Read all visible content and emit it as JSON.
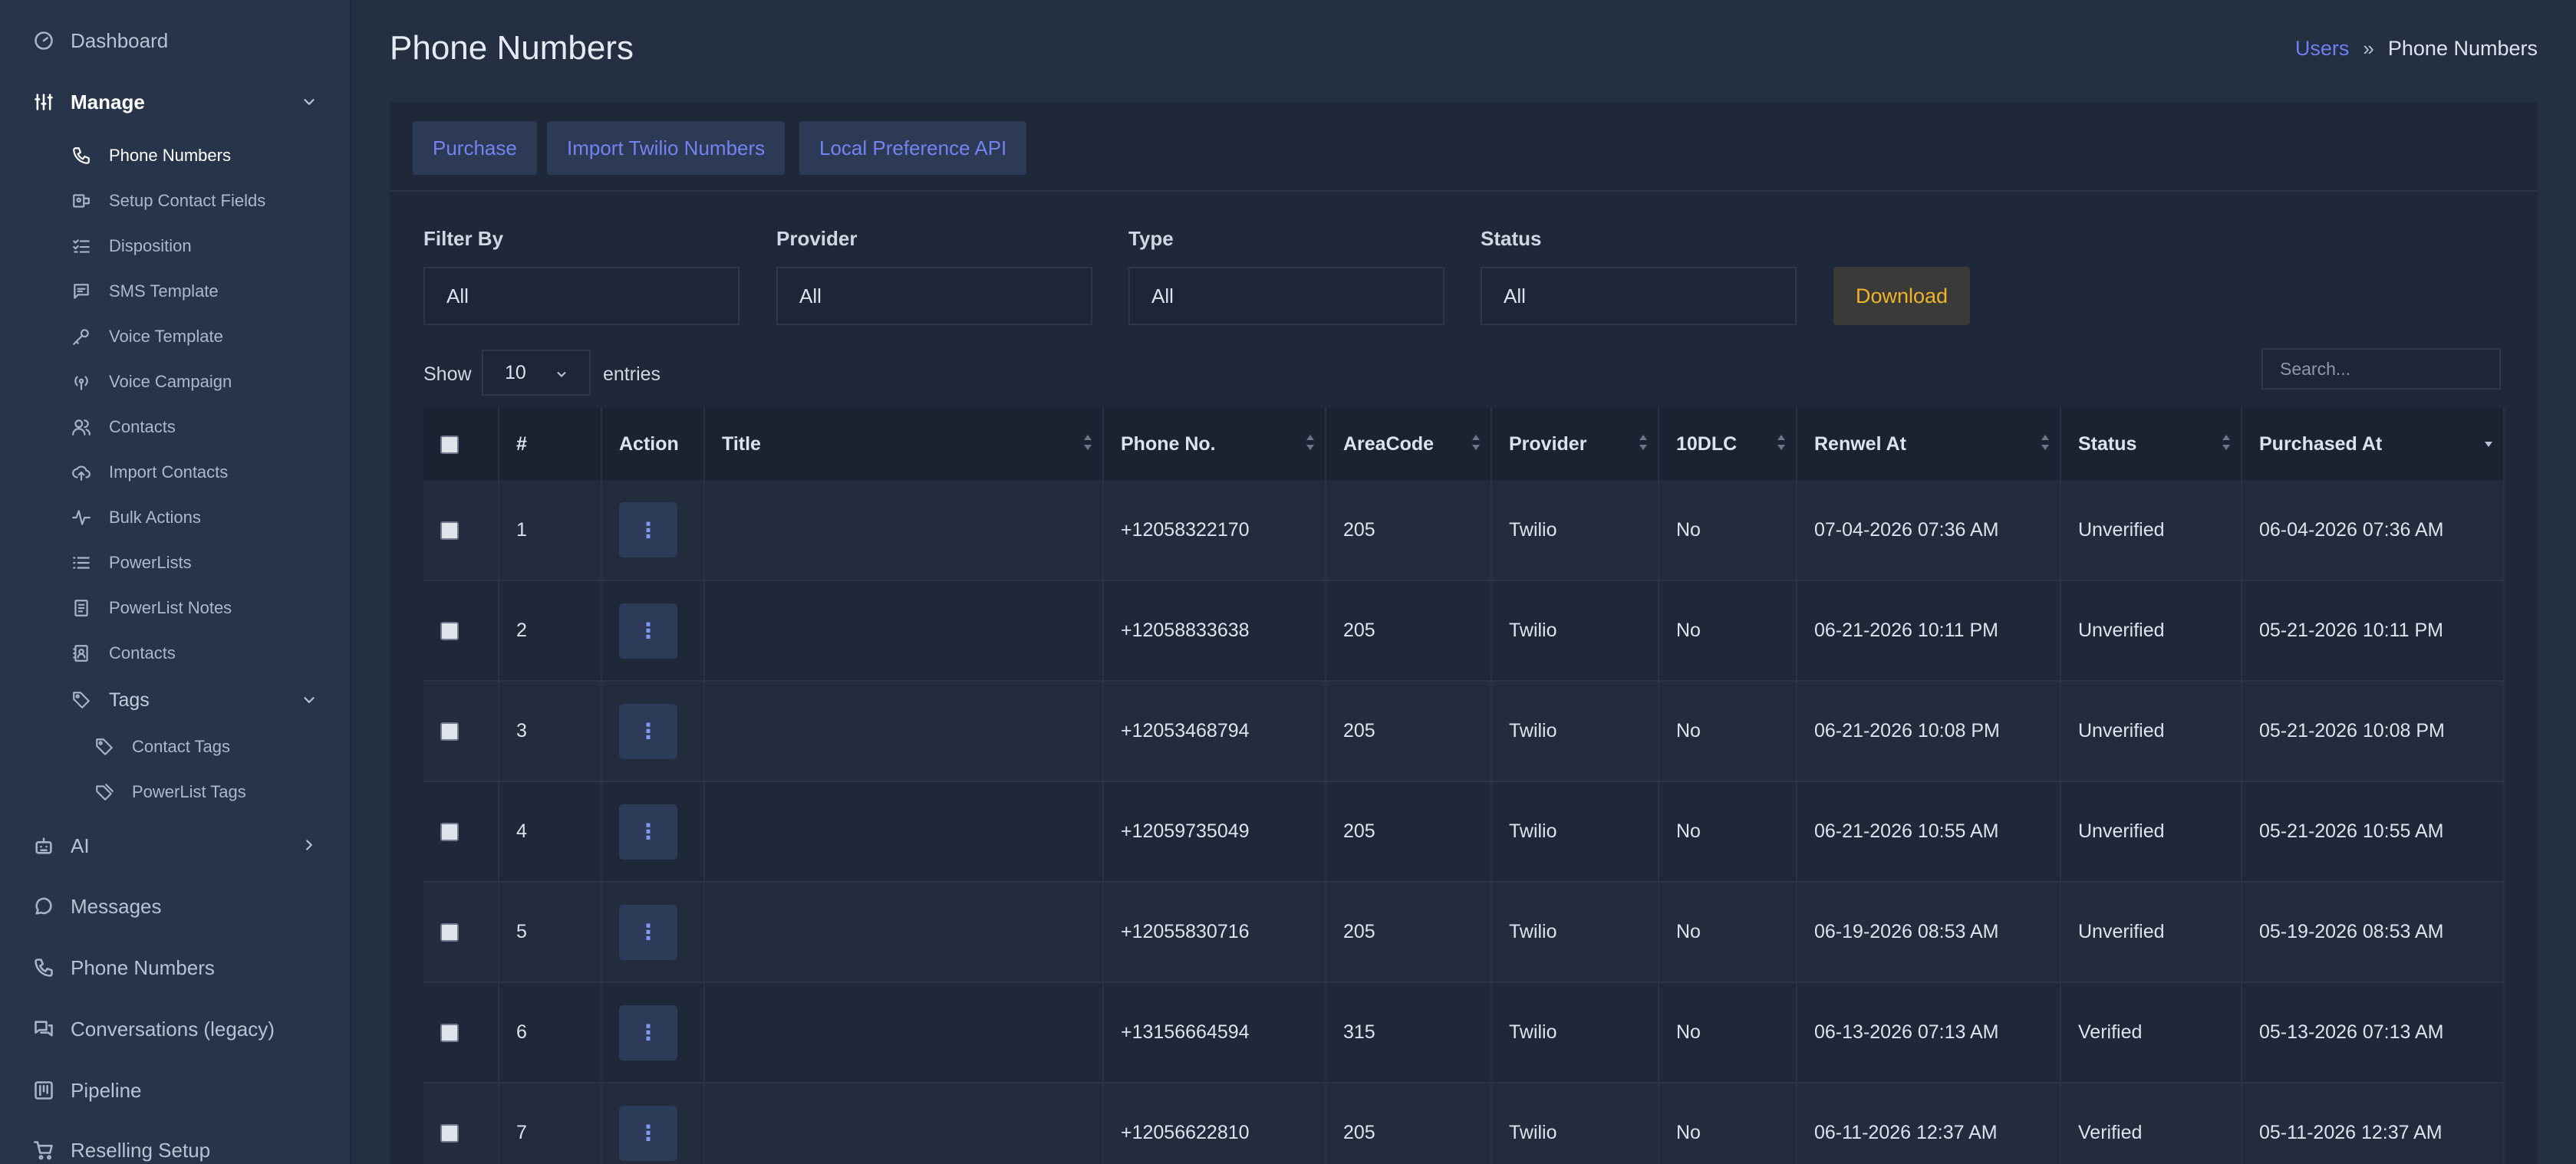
{
  "sidebar": {
    "dashboard": "Dashboard",
    "manage": "Manage",
    "manage_items": [
      "Phone Numbers",
      "Setup Contact Fields",
      "Disposition",
      "SMS Template",
      "Voice Template",
      "Voice Campaign",
      "Contacts",
      "Import Contacts",
      "Bulk Actions",
      "PowerLists",
      "PowerList Notes",
      "Contacts"
    ],
    "tags": "Tags",
    "tag_items": [
      "Contact Tags",
      "PowerList Tags"
    ],
    "ai": "AI",
    "messages": "Messages",
    "phone_numbers": "Phone Numbers",
    "conversations": "Conversations (legacy)",
    "pipeline": "Pipeline",
    "reselling": "Reselling Setup"
  },
  "header": {
    "title": "Phone Numbers",
    "breadcrumb_link": "Users",
    "breadcrumb_sep": "»",
    "breadcrumb_current": "Phone Numbers"
  },
  "toolbar": {
    "purchase": "Purchase",
    "import_twilio": "Import Twilio Numbers",
    "local_pref": "Local Preference API"
  },
  "filters": {
    "filter_by": {
      "label": "Filter By",
      "value": "All"
    },
    "provider": {
      "label": "Provider",
      "value": "All"
    },
    "type": {
      "label": "Type",
      "value": "All"
    },
    "status": {
      "label": "Status",
      "value": "All"
    },
    "download": "Download"
  },
  "entries": {
    "show": "Show",
    "count": "10",
    "suffix": "entries",
    "search_placeholder": "Search..."
  },
  "table": {
    "columns": [
      "#",
      "Action",
      "Title",
      "Phone No.",
      "AreaCode",
      "Provider",
      "10DLC",
      "Renwel At",
      "Status",
      "Purchased At"
    ],
    "rows": [
      {
        "n": "1",
        "title": "",
        "phone": "+12058322170",
        "area": "205",
        "provider": "Twilio",
        "dlc": "No",
        "renew": "07-04-2026 07:36 AM",
        "status": "Unverified",
        "purchased": "06-04-2026 07:36 AM"
      },
      {
        "n": "2",
        "title": "",
        "phone": "+12058833638",
        "area": "205",
        "provider": "Twilio",
        "dlc": "No",
        "renew": "06-21-2026 10:11 PM",
        "status": "Unverified",
        "purchased": "05-21-2026 10:11 PM"
      },
      {
        "n": "3",
        "title": "",
        "phone": "+12053468794",
        "area": "205",
        "provider": "Twilio",
        "dlc": "No",
        "renew": "06-21-2026 10:08 PM",
        "status": "Unverified",
        "purchased": "05-21-2026 10:08 PM"
      },
      {
        "n": "4",
        "title": "",
        "phone": "+12059735049",
        "area": "205",
        "provider": "Twilio",
        "dlc": "No",
        "renew": "06-21-2026 10:55 AM",
        "status": "Unverified",
        "purchased": "05-21-2026 10:55 AM"
      },
      {
        "n": "5",
        "title": "",
        "phone": "+12055830716",
        "area": "205",
        "provider": "Twilio",
        "dlc": "No",
        "renew": "06-19-2026 08:53 AM",
        "status": "Unverified",
        "purchased": "05-19-2026 08:53 AM"
      },
      {
        "n": "6",
        "title": "",
        "phone": "+13156664594",
        "area": "315",
        "provider": "Twilio",
        "dlc": "No",
        "renew": "06-13-2026 07:13 AM",
        "status": "Verified",
        "purchased": "05-13-2026 07:13 AM"
      },
      {
        "n": "7",
        "title": "",
        "phone": "+12056622810",
        "area": "205",
        "provider": "Twilio",
        "dlc": "No",
        "renew": "06-11-2026 12:37 AM",
        "status": "Verified",
        "purchased": "05-11-2026 12:37 AM"
      }
    ]
  },
  "action_glyph": "⋮"
}
